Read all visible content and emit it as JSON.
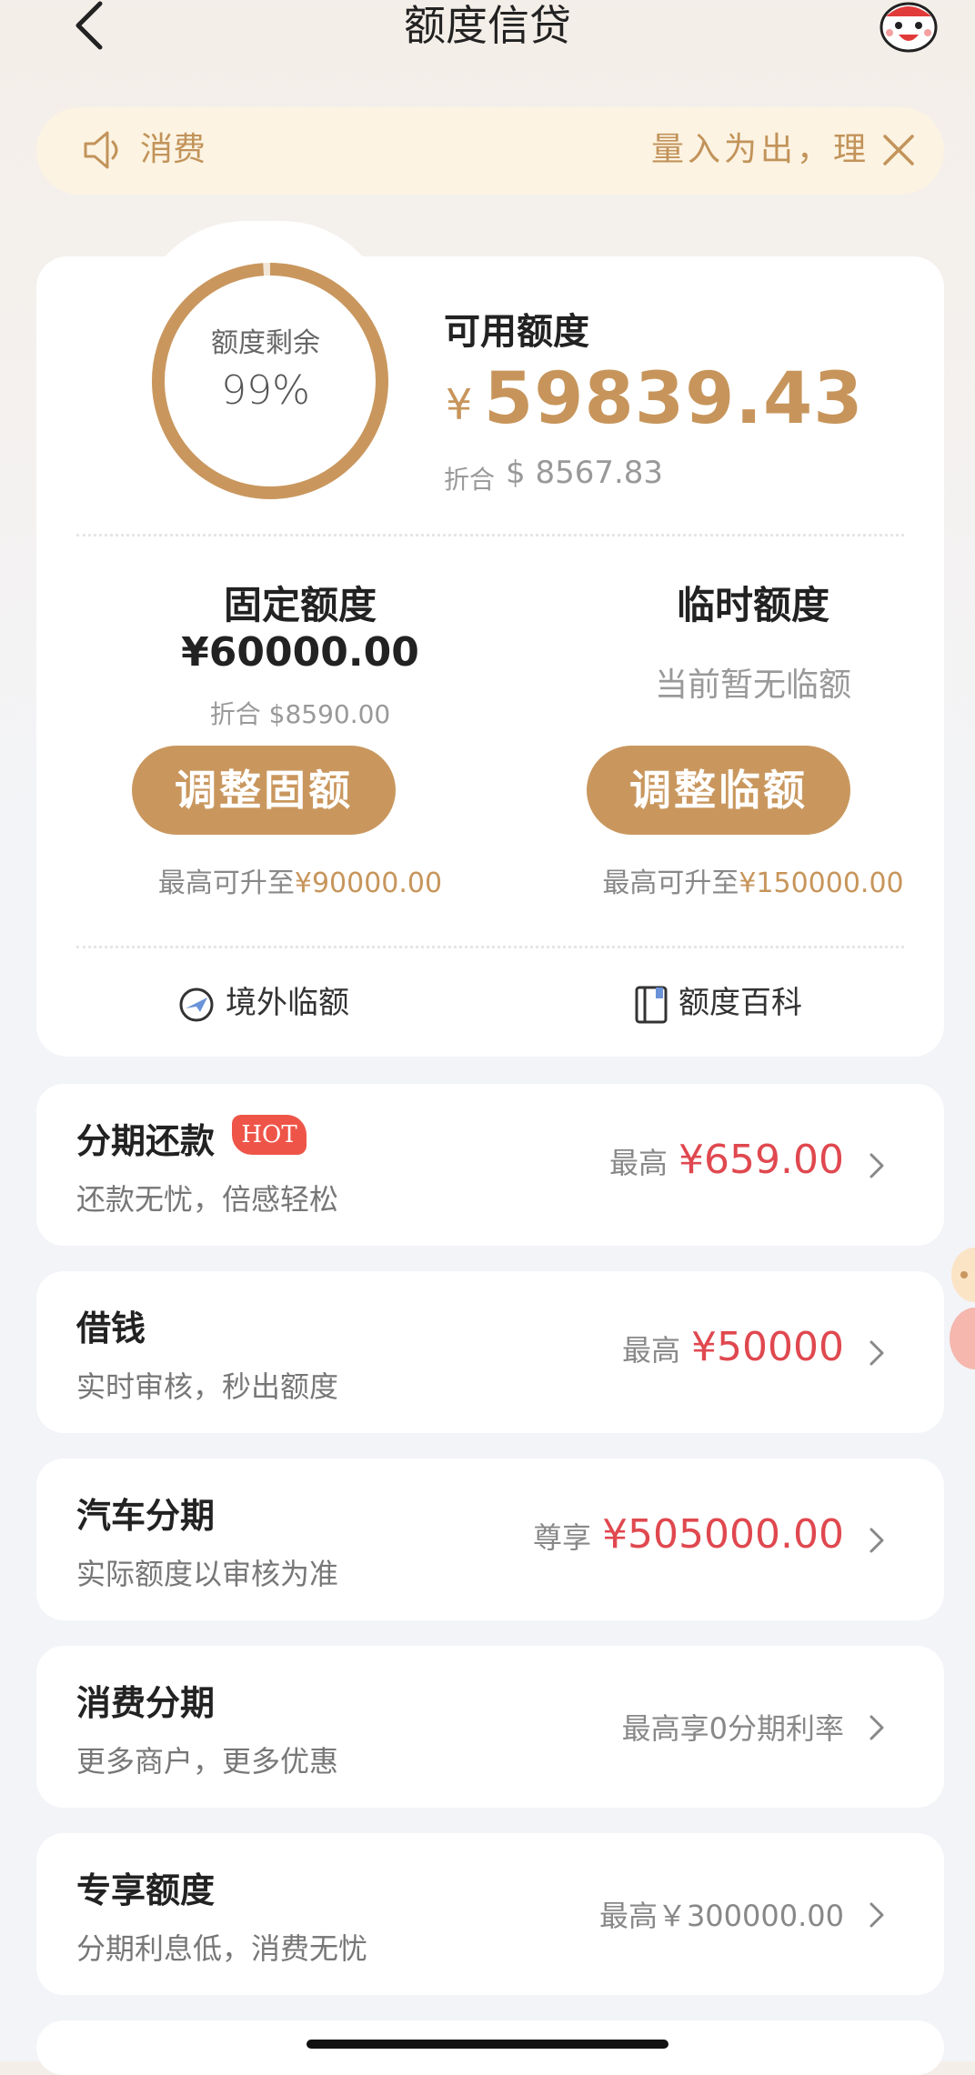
{
  "header": {
    "title": "额度信贷",
    "back_icon": "chevron-left-icon",
    "mascot_icon": "mascot-icon"
  },
  "notice": {
    "left_text": "消费",
    "scroll_text": "量入为出，理",
    "icon": "speaker-icon",
    "close_icon": "close-icon"
  },
  "credit": {
    "ring_label": "额度剩余",
    "ring_percent": "99%",
    "ring_fraction": 0.99,
    "available_label": "可用额度",
    "available_currency": "¥",
    "available_amount": "59839.43",
    "converted_label": "折合",
    "converted_amount": "$ 8567.83",
    "fixed": {
      "title": "固定额度",
      "amount": "¥60000.00",
      "converted": "折合 $8590.00",
      "button": "调整固额",
      "max_prefix": "最高可升至",
      "max_value": "¥90000.00"
    },
    "temp": {
      "title": "临时额度",
      "status": "当前暂无临额",
      "button": "调整临额",
      "max_prefix": "最高可升至",
      "max_value": "¥150000.00"
    },
    "links": [
      {
        "label": "境外临额",
        "icon": "overseas-plane-icon"
      },
      {
        "label": "额度百科",
        "icon": "book-icon"
      }
    ]
  },
  "list": [
    {
      "title": "分期还款",
      "badge": "HOT",
      "subtitle": "还款无忧，倍感轻松",
      "prefix": "最高",
      "value": "¥659.00"
    },
    {
      "title": "借钱",
      "subtitle": "实时审核，秒出额度",
      "prefix": "最高",
      "value": "¥50000"
    },
    {
      "title": "汽车分期",
      "subtitle": "实际额度以审核为准",
      "prefix": "尊享",
      "value": "¥505000.00"
    },
    {
      "title": "消费分期",
      "subtitle": "更多商户，更多优惠",
      "note": "最高享0分期利率"
    },
    {
      "title": "专享额度",
      "subtitle": "分期利息低，消费无忧",
      "note": "最高￥300000.00"
    }
  ],
  "colors": {
    "gold": "#c9975e",
    "red": "#e0484f",
    "notice_bg": "#fcf3e2"
  }
}
